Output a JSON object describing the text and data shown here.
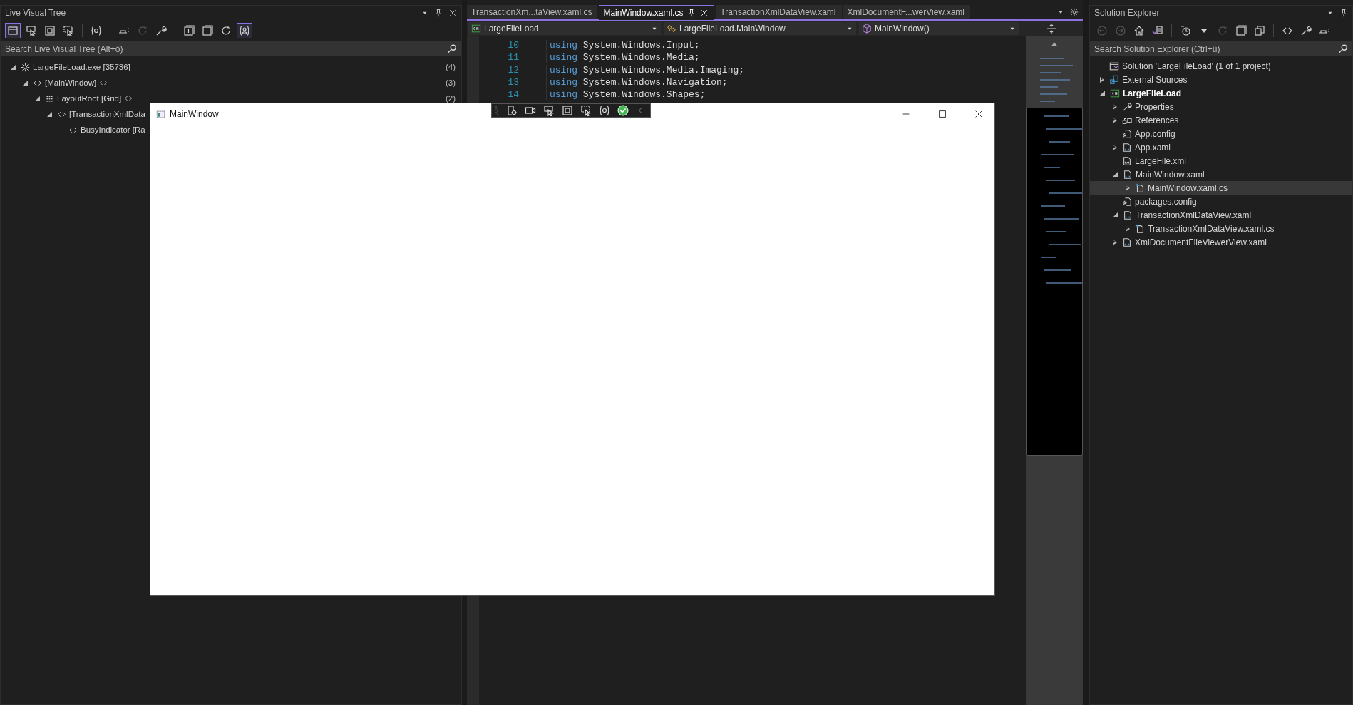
{
  "live_visual_tree": {
    "title": "Live Visual Tree",
    "toolbar_groups": [
      [
        {
          "selected": true,
          "disabled": false
        },
        {
          "selected": false,
          "disabled": false
        },
        {
          "selected": false,
          "disabled": false
        },
        {
          "selected": false,
          "disabled": false
        }
      ],
      [
        {
          "selected": false,
          "disabled": false
        }
      ],
      [
        {
          "selected": false,
          "disabled": false
        },
        {
          "selected": false,
          "disabled": true
        },
        {
          "selected": false,
          "disabled": false
        }
      ],
      [
        {
          "selected": false,
          "disabled": false
        },
        {
          "selected": false,
          "disabled": false
        },
        {
          "selected": false,
          "disabled": false
        },
        {
          "selected": true,
          "disabled": false
        }
      ]
    ],
    "search": {
      "placeholder": "Search Live Visual Tree (Alt+ö)"
    },
    "tree": [
      {
        "kind": "process",
        "label": "LargeFileLoad.exe [35736]",
        "count": "(4)",
        "expanded": true,
        "children": [
          {
            "kind": "element",
            "label": "[MainWindow]",
            "count": "(3)",
            "source_link": true,
            "expanded": true,
            "children": [
              {
                "kind": "grid",
                "label": "LayoutRoot [Grid]",
                "count": "(2)",
                "source_link": true,
                "expanded": true,
                "children": [
                  {
                    "kind": "element",
                    "label": "[TransactionXmlData",
                    "expanded": true,
                    "children": [
                      {
                        "kind": "element",
                        "label": "BusyIndicator [Ra"
                      }
                    ]
                  }
                ]
              }
            ]
          }
        ]
      }
    ]
  },
  "editor": {
    "tabs": [
      {
        "label": "TransactionXm...taView.xaml.cs",
        "selected": false
      },
      {
        "label": "MainWindow.xaml.cs",
        "selected": true
      },
      {
        "label": "TransactionXmlDataView.xaml",
        "selected": false
      },
      {
        "label": "XmlDocumentF...werView.xaml",
        "selected": false
      }
    ],
    "navigation": [
      {
        "kind": "project",
        "label": "LargeFileLoad"
      },
      {
        "kind": "class",
        "label": "LargeFileLoad.MainWindow"
      },
      {
        "kind": "method",
        "label": "MainWindow()"
      }
    ],
    "lines": [
      {
        "number": "10",
        "keyword": "using",
        "code": "System.Windows.Input;"
      },
      {
        "number": "11",
        "keyword": "using",
        "code": "System.Windows.Media;"
      },
      {
        "number": "12",
        "keyword": "using",
        "code": "System.Windows.Media.Imaging;"
      },
      {
        "number": "13",
        "keyword": "using",
        "code": "System.Windows.Navigation;"
      },
      {
        "number": "14",
        "keyword": "using",
        "code": "System.Windows.Shapes;"
      }
    ]
  },
  "solution_explorer": {
    "title": "Solution Explorer",
    "toolbar_groups": [
      [
        {
          "disabled": true
        },
        {
          "disabled": true
        },
        {
          "disabled": false
        },
        {
          "disabled": false
        }
      ],
      [
        {
          "disabled": false
        },
        {
          "disabled": false
        },
        {
          "disabled": true
        },
        {
          "disabled": false
        },
        {
          "disabled": false
        }
      ],
      [
        {
          "disabled": false
        },
        {
          "disabled": false
        },
        {
          "disabled": false
        }
      ]
    ],
    "search": {
      "placeholder": "Search Solution Explorer (Ctrl+ü)"
    },
    "tree": [
      {
        "kind": "solution",
        "label": "Solution 'LargeFileLoad' (1 of 1 project)",
        "selected": false
      },
      {
        "kind": "external",
        "label": "External Sources",
        "expanded": false,
        "selected": false
      },
      {
        "kind": "project",
        "label": "LargeFileLoad",
        "expanded": true,
        "selected": false,
        "children": [
          {
            "kind": "properties",
            "label": "Properties",
            "expanded": false,
            "selected": false
          },
          {
            "kind": "references",
            "label": "References",
            "expanded": false,
            "selected": false
          },
          {
            "kind": "config",
            "label": "App.config",
            "selected": false
          },
          {
            "kind": "xaml",
            "label": "App.xaml",
            "expanded": false,
            "selected": false
          },
          {
            "kind": "xml",
            "label": "LargeFile.xml",
            "selected": false
          },
          {
            "kind": "xaml",
            "label": "MainWindow.xaml",
            "expanded": true,
            "selected": false,
            "children": [
              {
                "kind": "cs",
                "label": "MainWindow.xaml.cs",
                "expanded": false,
                "selected": true
              }
            ]
          },
          {
            "kind": "config",
            "label": "packages.config",
            "selected": false
          },
          {
            "kind": "xaml",
            "label": "TransactionXmlDataView.xaml",
            "expanded": true,
            "selected": false,
            "children": [
              {
                "kind": "cs",
                "label": "TransactionXmlDataView.xaml.cs",
                "expanded": false,
                "selected": false
              }
            ]
          },
          {
            "kind": "xaml",
            "label": "XmlDocumentFileViewerView.xaml",
            "expanded": false,
            "selected": false
          }
        ]
      }
    ]
  },
  "app_window": {
    "title": "MainWindow"
  }
}
